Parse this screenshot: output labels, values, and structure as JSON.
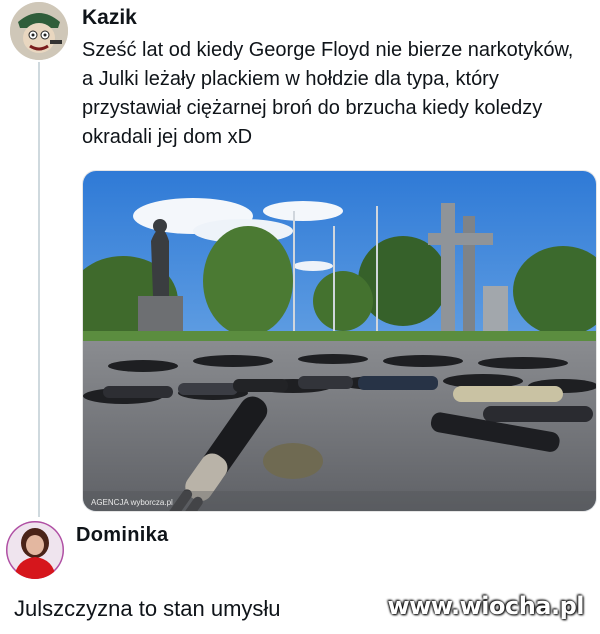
{
  "post": {
    "author": "Kazik",
    "text": "Sześć lat od kiedy George Floyd nie bierze narkotyków, a Julki leżały plackiem w hołdzie dla typa, który przystawiał ciężarnej broń do brzucha kiedy koledzy okradali jej dom xD",
    "photo": {
      "credit": "AGENCJA wyborcza.pl"
    }
  },
  "reply": {
    "author": "Dominika",
    "text": "Julszczyzna to stan umysłu"
  },
  "watermark": "www.wiocha.pl"
}
